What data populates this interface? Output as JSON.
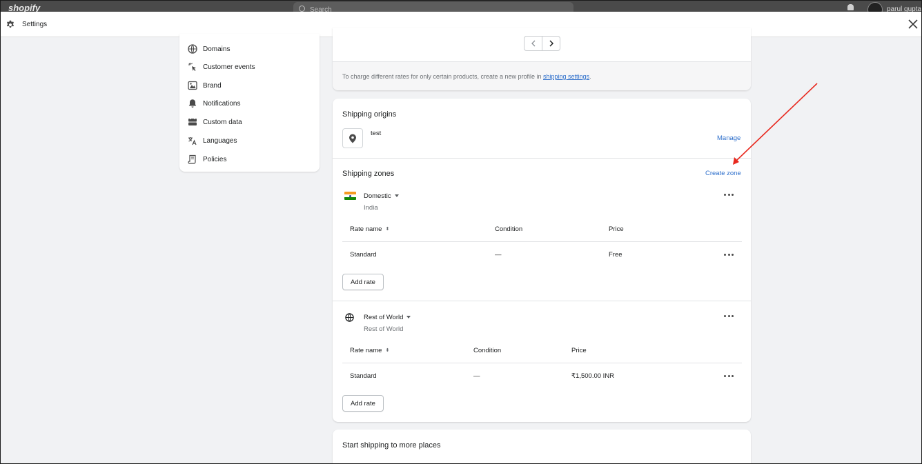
{
  "topbar": {
    "logo": "shopify",
    "search_placeholder": "Search",
    "user": "parul gupta"
  },
  "settings_bar": {
    "title": "Settings"
  },
  "sidebar": {
    "items": [
      {
        "label": "Domains",
        "icon": "globe-icon"
      },
      {
        "label": "Customer events",
        "icon": "cursor-click-icon"
      },
      {
        "label": "Brand",
        "icon": "brand-icon"
      },
      {
        "label": "Notifications",
        "icon": "bell-icon"
      },
      {
        "label": "Custom data",
        "icon": "custom-data-icon"
      },
      {
        "label": "Languages",
        "icon": "translate-icon"
      },
      {
        "label": "Policies",
        "icon": "policy-icon"
      }
    ]
  },
  "profile_card": {
    "footer_text": "To charge different rates for only certain products, create a new profile in ",
    "footer_link": "shipping settings",
    "footer_suffix": "."
  },
  "shipping_origins": {
    "title": "Shipping origins",
    "location_name": "test",
    "manage_label": "Manage"
  },
  "shipping_zones": {
    "title": "Shipping zones",
    "create_label": "Create zone",
    "zones": [
      {
        "name": "Domestic",
        "subtitle": "India",
        "headers": {
          "rate_name": "Rate name",
          "condition": "Condition",
          "price": "Price"
        },
        "rates": [
          {
            "name": "Standard",
            "condition": "—",
            "price": "Free"
          }
        ],
        "add_rate_label": "Add rate"
      },
      {
        "name": "Rest of World",
        "subtitle": "Rest of World",
        "headers": {
          "rate_name": "Rate name",
          "condition": "Condition",
          "price": "Price"
        },
        "rates": [
          {
            "name": "Standard",
            "condition": "—",
            "price": "₹1,500.00 INR"
          }
        ],
        "add_rate_label": "Add rate"
      }
    ]
  },
  "more_places": {
    "title": "Start shipping to more places"
  },
  "colors": {
    "accent_link": "#2c6ecb",
    "annotation_arrow": "#e8281e",
    "topbar_bg": "#4a4a4a",
    "page_bg": "#f1f2f4"
  }
}
